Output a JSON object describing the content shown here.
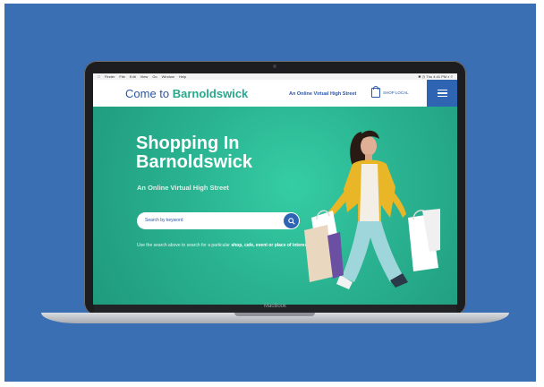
{
  "menubar": {
    "items": [
      "Finder",
      "File",
      "Edit",
      "View",
      "Go",
      "Window",
      "Help"
    ],
    "status": "✱ ◷ Thu 4:41 PM ⌕ ≡"
  },
  "header": {
    "logo_prefix": "Come to ",
    "logo_name": "Barnoldswick",
    "tagline": "An Online Virtual High Street",
    "shop_local_label": "SHOP LOCAL",
    "menu_icon": "hamburger-icon"
  },
  "hero": {
    "title": "Shopping In Barnoldswick",
    "subtitle": "An Online Virtual High Street",
    "search": {
      "placeholder": "Search by keyword",
      "value": ""
    },
    "hint_text": "Use the search above to search for a particular ",
    "hint_bold": "shop, cafe, event or place of interest."
  },
  "device": {
    "label": "MacBook"
  },
  "colors": {
    "brand_blue": "#2a56a8",
    "brand_green": "#27a88c",
    "hero_teal": "#2ab391",
    "background": "#3a6fb4"
  }
}
